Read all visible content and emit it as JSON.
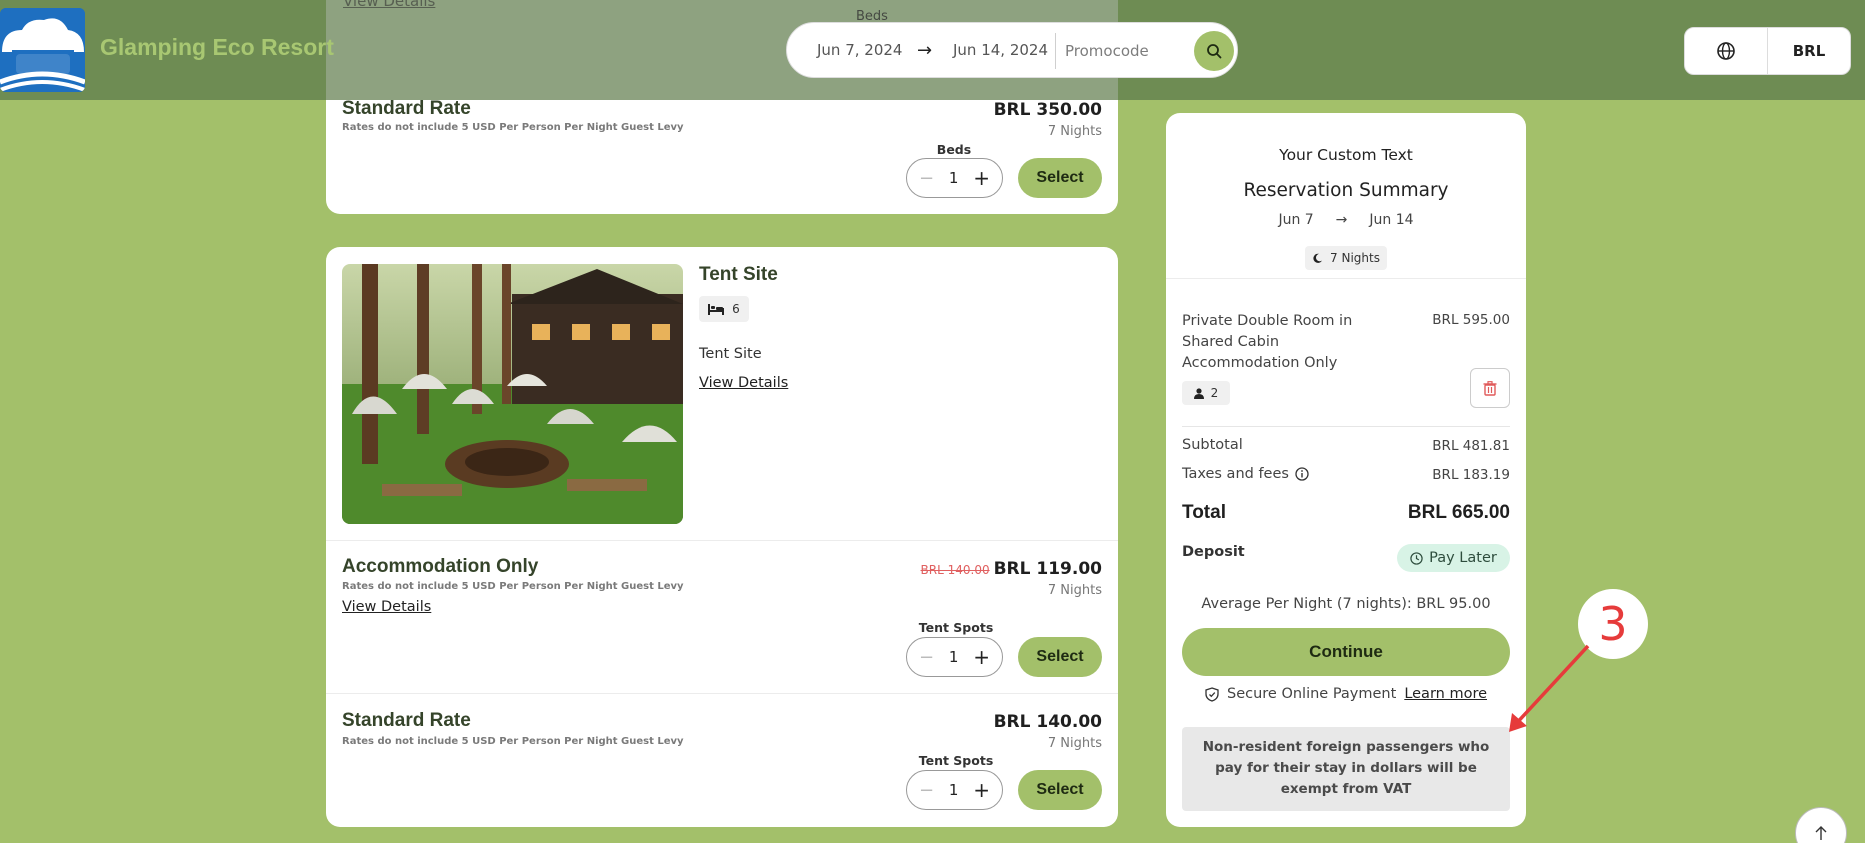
{
  "header": {
    "brand": "Glamping Eco Resort",
    "hidden_link": "View Details",
    "hidden_beds_label": "Beds",
    "search": {
      "check_in": "Jun 7, 2024",
      "check_out": "Jun 14, 2024",
      "promo_placeholder": "Promocode"
    },
    "currency": "BRL"
  },
  "card_top": {
    "rate_title": "Standard Rate",
    "rate_note": "Rates do not include 5 USD Per Person Per Night Guest Levy",
    "price": "BRL 350.00",
    "nights": "7 Nights",
    "qty_label": "Beds",
    "qty_value": "1",
    "select_label": "Select"
  },
  "tent_card": {
    "title": "Tent Site",
    "beds_count": "6",
    "description": "Tent Site",
    "view_details": "View Details",
    "rates": [
      {
        "title": "Accommodation Only",
        "note": "Rates do not include 5 USD Per Person Per Night Guest Levy",
        "old_price": "BRL 140.00",
        "price": "BRL 119.00",
        "nights": "7 Nights",
        "view_details": "View Details",
        "qty_label": "Tent Spots",
        "qty_value": "1",
        "select_label": "Select"
      },
      {
        "title": "Standard Rate",
        "note": "Rates do not include 5 USD Per Person Per Night Guest Levy",
        "price": "BRL 140.00",
        "nights": "7 Nights",
        "qty_label": "Tent Spots",
        "qty_value": "1",
        "select_label": "Select"
      }
    ]
  },
  "summary": {
    "custom_text": "Your Custom Text",
    "title": "Reservation Summary",
    "date_from": "Jun 7",
    "date_to": "Jun 14",
    "nights": "7 Nights",
    "item_name": "Private Double Room in Shared Cabin Accommodation Only",
    "item_price": "BRL 595.00",
    "guests": "2",
    "subtotal_label": "Subtotal",
    "subtotal_value": "BRL 481.81",
    "taxes_label": "Taxes and fees",
    "taxes_value": "BRL 183.19",
    "total_label": "Total",
    "total_value": "BRL 665.00",
    "deposit_label": "Deposit",
    "pay_later": "Pay Later",
    "average": "Average Per Night (7 nights): BRL 95.00",
    "continue_label": "Continue",
    "secure_text": "Secure Online Payment",
    "learn_more": "Learn more",
    "vat_notice": "Non-resident foreign passengers who pay for their stay in dollars will be exempt from VAT"
  },
  "annotation": {
    "label": "3"
  },
  "colors": {
    "accent": "#a3c06a",
    "header": "#6e8c53",
    "annotation": "#e63b3b"
  }
}
